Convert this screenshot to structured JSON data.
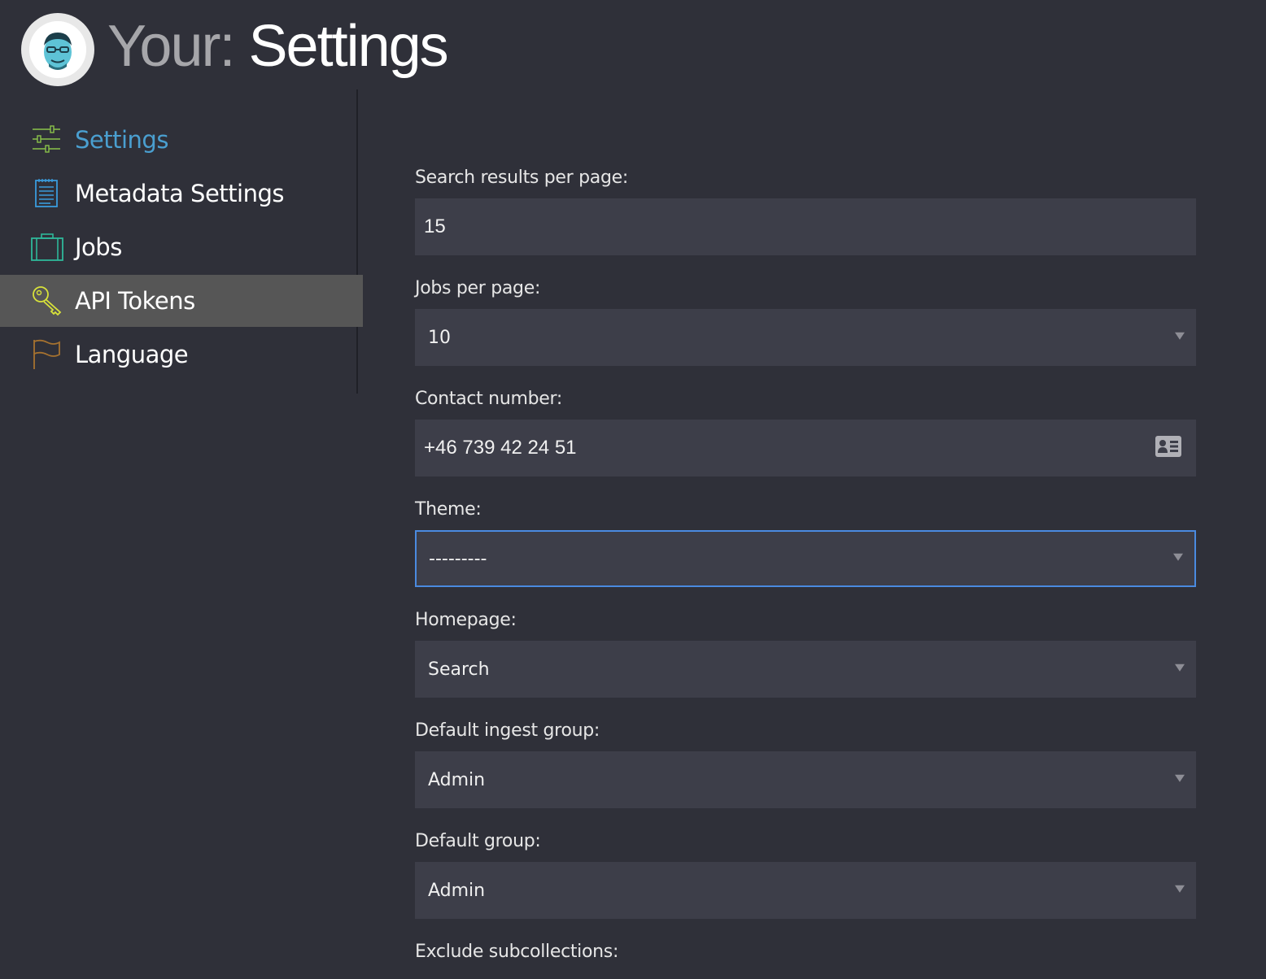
{
  "header": {
    "title_prefix": "Your:",
    "title_main": "Settings",
    "avatar_icon": "user-avatar"
  },
  "sidebar": {
    "items": [
      {
        "label": "Settings",
        "icon": "sliders-icon",
        "selected": true
      },
      {
        "label": "Metadata Settings",
        "icon": "notepad-icon"
      },
      {
        "label": "Jobs",
        "icon": "briefcase-icon"
      },
      {
        "label": "API Tokens",
        "icon": "key-icon",
        "hovered": true
      },
      {
        "label": "Language",
        "icon": "flag-icon"
      }
    ]
  },
  "form": {
    "search_results": {
      "label": "Search results per page:",
      "value": "15"
    },
    "jobs_per_page": {
      "label": "Jobs per page:",
      "value": "10"
    },
    "contact_number": {
      "label": "Contact number:",
      "value": "+46 739 42 24 51",
      "icon": "contact-card-icon"
    },
    "theme": {
      "label": "Theme:",
      "value": "---------"
    },
    "homepage": {
      "label": "Homepage:",
      "value": "Search"
    },
    "default_ingest_group": {
      "label": "Default ingest group:",
      "value": "Admin"
    },
    "default_group": {
      "label": "Default group:",
      "value": "Admin"
    },
    "exclude_subcollections": {
      "label": "Exclude subcollections:"
    }
  },
  "colors": {
    "background": "#2f3039",
    "field_background": "#3d3e49",
    "accent": "#4a9fd0",
    "focus_border": "#4a8ae0",
    "active_nav": "#565656"
  }
}
